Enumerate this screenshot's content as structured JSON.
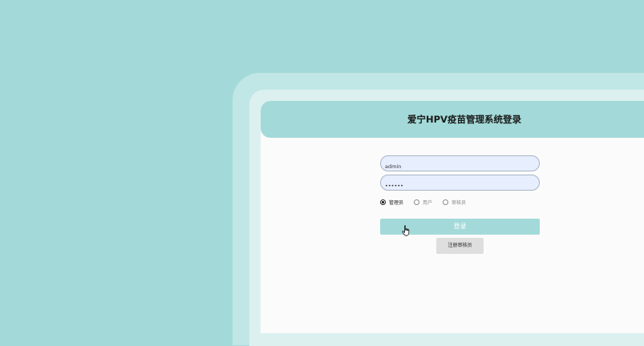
{
  "login": {
    "title": "爱宁HPV疫苗管理系统登录",
    "username_value": "admin",
    "password_value": "123456",
    "roles": [
      {
        "label": "管理员",
        "checked": true
      },
      {
        "label": "用户",
        "checked": false
      },
      {
        "label": "审核员",
        "checked": false
      }
    ],
    "login_label": "登录",
    "register_label": "注册审核员"
  },
  "colors": {
    "accent": "#a3dad9",
    "card": "#fbfbfb",
    "input_bg": "#e7efff"
  },
  "icons": {
    "cursor": "hand-pointer-icon"
  }
}
